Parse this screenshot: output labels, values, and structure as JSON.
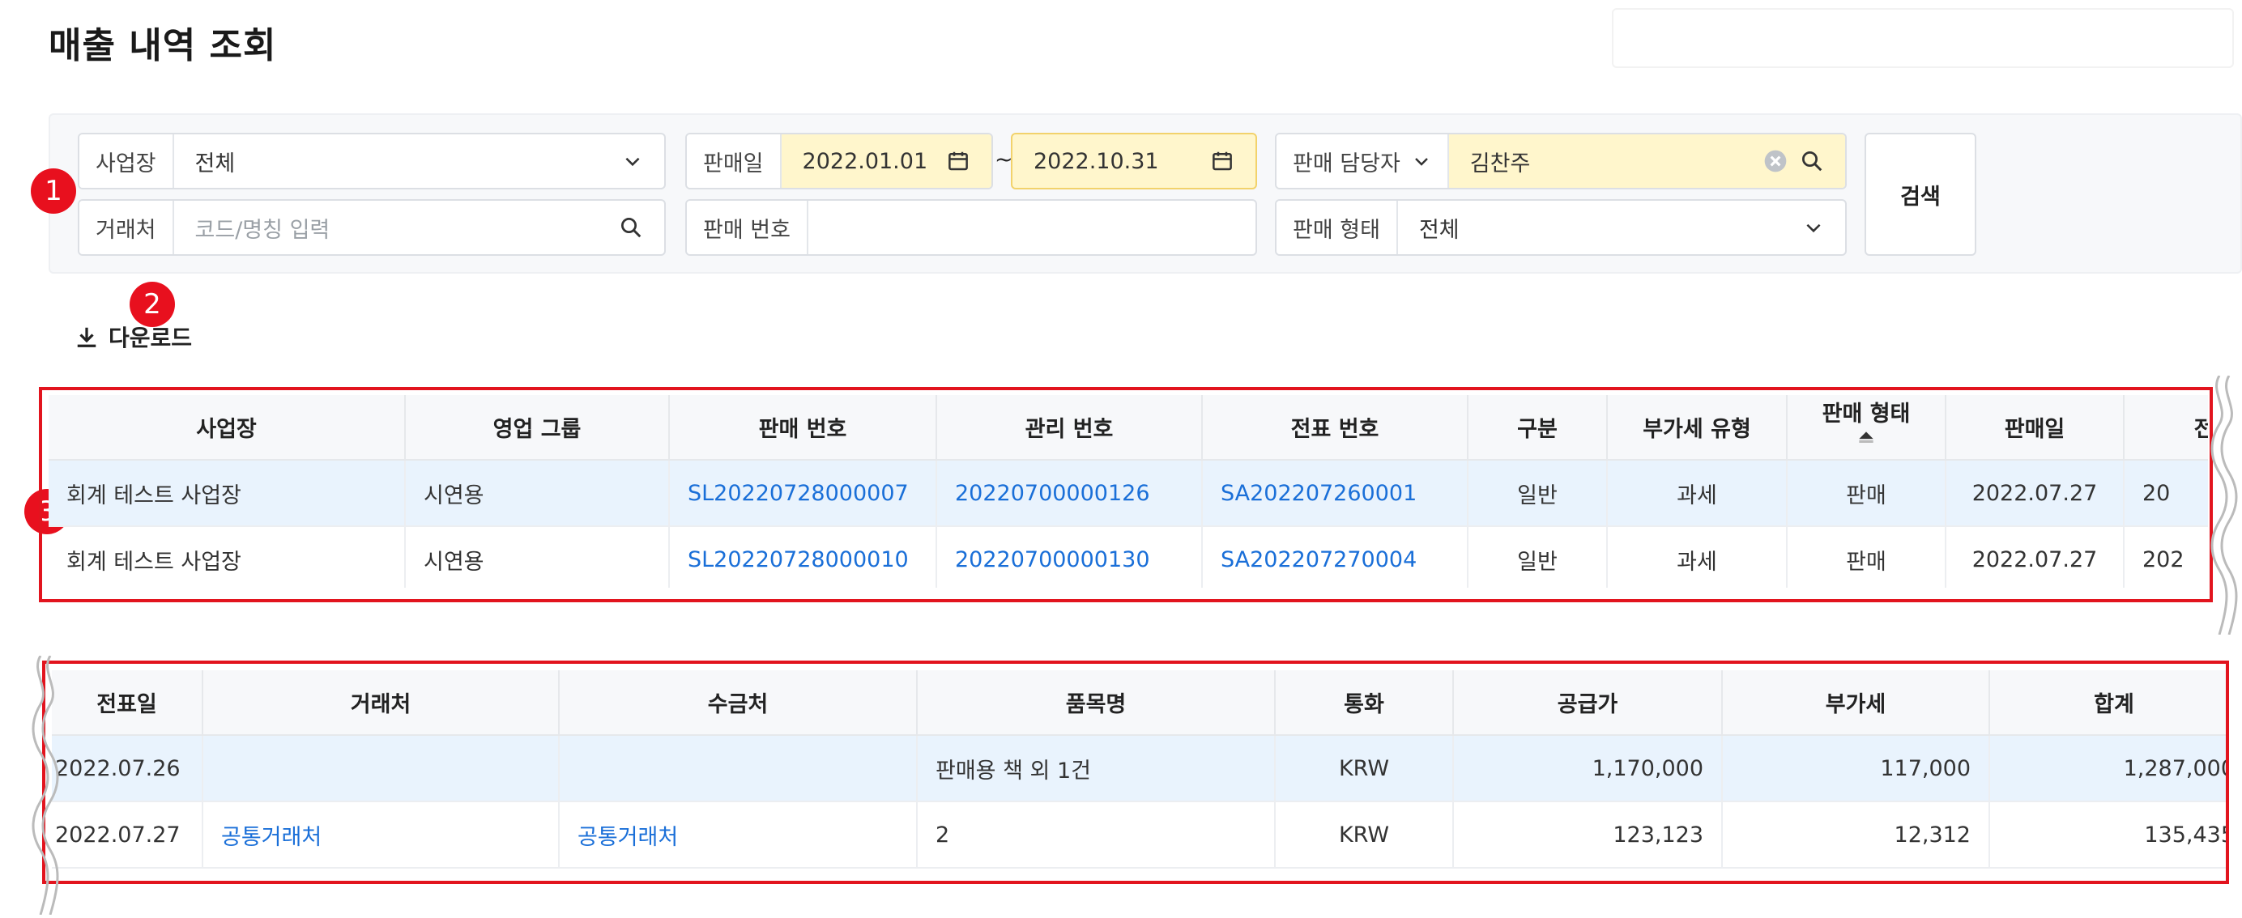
{
  "page": {
    "title": "매출 내역 조회"
  },
  "filters": {
    "business_label": "사업장",
    "business_value": "전체",
    "client_label": "거래처",
    "client_placeholder": "코드/명칭 입력",
    "sale_date_label": "판매일",
    "date_from": "2022.01.01",
    "date_sep": "~",
    "date_to": "2022.10.31",
    "sale_no_label": "판매 번호",
    "sale_no_value": "",
    "manager_label": "판매 담당자",
    "manager_value": "김찬주",
    "sale_type_label": "판매 형태",
    "sale_type_value": "전체",
    "search_label": "검색"
  },
  "download": {
    "label": "다운로드"
  },
  "badges": [
    "1",
    "2",
    "3"
  ],
  "table1": {
    "headers": [
      "사업장",
      "영업 그룹",
      "판매 번호",
      "관리 번호",
      "전표 번호",
      "구분",
      "부가세 유형",
      "판매 형태",
      "판매일",
      "전"
    ],
    "rows": [
      [
        "회계 테스트 사업장",
        "시연용",
        "SL20220728000007",
        "20220700000126",
        "SA202207260001",
        "일반",
        "과세",
        "판매",
        "2022.07.27",
        "20"
      ],
      [
        "회계 테스트 사업장",
        "시연용",
        "SL20220728000010",
        "20220700000130",
        "SA202207270004",
        "일반",
        "과세",
        "판매",
        "2022.07.27",
        "202"
      ]
    ]
  },
  "table2": {
    "headers": [
      "전표일",
      "거래처",
      "수금처",
      "품목명",
      "통화",
      "공급가",
      "부가세",
      "합계"
    ],
    "rows": [
      [
        "2022.07.26",
        "",
        "",
        "판매용 책 외 1건",
        "KRW",
        "1,170,000",
        "117,000",
        "1,287,000"
      ],
      [
        "2022.07.27",
        "공통거래처",
        "공통거래처",
        "2",
        "KRW",
        "123,123",
        "12,312",
        "135,435"
      ]
    ]
  },
  "colors": {
    "accent": "#1a6fd8",
    "highlight": "#e9f3fd",
    "annotation": "#e2141e",
    "date_bg": "#fff6cc"
  }
}
